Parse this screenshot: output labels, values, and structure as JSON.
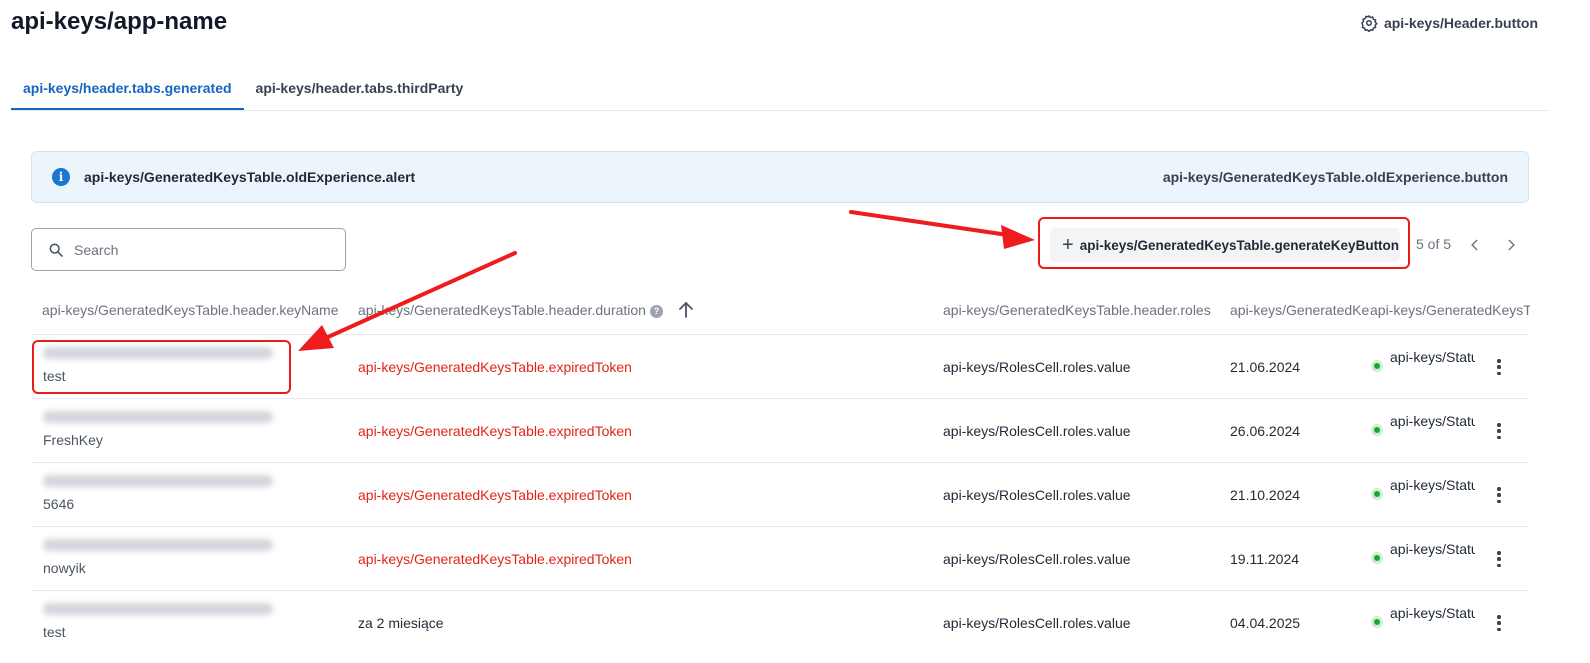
{
  "page": {
    "title": "api-keys/app-name",
    "header_button": "api-keys/Header.button"
  },
  "tabs": [
    {
      "label": "api-keys/header.tabs.generated",
      "active": true
    },
    {
      "label": "api-keys/header.tabs.thirdParty",
      "active": false
    }
  ],
  "alert": {
    "text": "api-keys/GeneratedKeysTable.oldExperience.alert",
    "button": "api-keys/GeneratedKeysTable.oldExperience.button"
  },
  "search": {
    "placeholder": "Search",
    "value": ""
  },
  "toolbar": {
    "generate_label": "api-keys/GeneratedKeysTable.generateKeyButton",
    "pagination": "5 of 5"
  },
  "table": {
    "headers": {
      "keyName": "api-keys/GeneratedKeysTable.header.keyName",
      "duration": "api-keys/GeneratedKeysTable.header.duration",
      "roles": "api-keys/GeneratedKeysTable.header.roles",
      "created": "api-keys/GeneratedKeysTable.header.c",
      "status": "api-keys/GeneratedKeysTa"
    },
    "duration_help": "?",
    "rows": [
      {
        "key_name": "test",
        "duration": "api-keys/GeneratedKeysTable.expiredToken",
        "expired": true,
        "roles": "api-keys/RolesCell.roles.value",
        "date": "21.06.2024",
        "status": "api-keys/StatusCell"
      },
      {
        "key_name": "FreshKey",
        "duration": "api-keys/GeneratedKeysTable.expiredToken",
        "expired": true,
        "roles": "api-keys/RolesCell.roles.value",
        "date": "26.06.2024",
        "status": "api-keys/StatusCell"
      },
      {
        "key_name": "5646",
        "duration": "api-keys/GeneratedKeysTable.expiredToken",
        "expired": true,
        "roles": "api-keys/RolesCell.roles.value",
        "date": "21.10.2024",
        "status": "api-keys/StatusCell"
      },
      {
        "key_name": "nowyik",
        "duration": "api-keys/GeneratedKeysTable.expiredToken",
        "expired": true,
        "roles": "api-keys/RolesCell.roles.value",
        "date": "19.11.2024",
        "status": "api-keys/StatusCell"
      },
      {
        "key_name": "test",
        "duration": "za 2 miesiące",
        "expired": false,
        "roles": "api-keys/RolesCell.roles.value",
        "date": "04.04.2025",
        "status": "api-keys/StatusCell"
      }
    ]
  },
  "colors": {
    "accent": "#1565c0",
    "expired": "#e3231b",
    "status_active": "#22a33a",
    "annotation": "#e81c1c",
    "alert_bg": "#edf5fc"
  }
}
